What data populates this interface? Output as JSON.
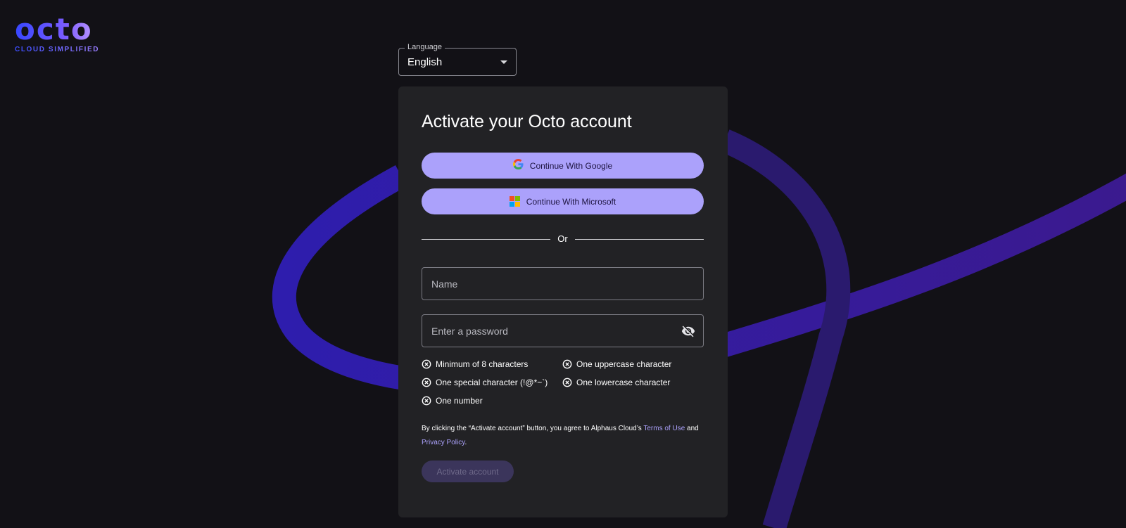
{
  "brand": {
    "name": "octo",
    "tagline": "CLOUD SIMPLIFIED"
  },
  "language": {
    "label": "Language",
    "value": "English"
  },
  "form": {
    "title": "Activate your Octo account",
    "google_label": "Continue With Google",
    "microsoft_label": "Continue With Microsoft",
    "divider_label": "Or",
    "name_placeholder": "Name",
    "password_placeholder": "Enter a password",
    "requirements": [
      "Minimum of 8 characters",
      "One uppercase character",
      "One special character (!@*~`)",
      "One lowercase character",
      "One number"
    ],
    "terms": {
      "prefix": "By clicking the “Activate account” button, you agree to Alphaus Cloud’s ",
      "terms_link": "Terms of Use",
      "middle": " and ",
      "privacy_link": "Privacy Policy",
      "suffix": "."
    },
    "activate_label": "Activate account"
  },
  "colors": {
    "background": "#121116",
    "card": "#222225",
    "accent": "#aba1fb",
    "button_disabled": "#3b355b"
  },
  "icons": [
    "google-icon",
    "microsoft-icon",
    "eye-off-icon",
    "close-circle-icon",
    "caret-down-icon"
  ]
}
